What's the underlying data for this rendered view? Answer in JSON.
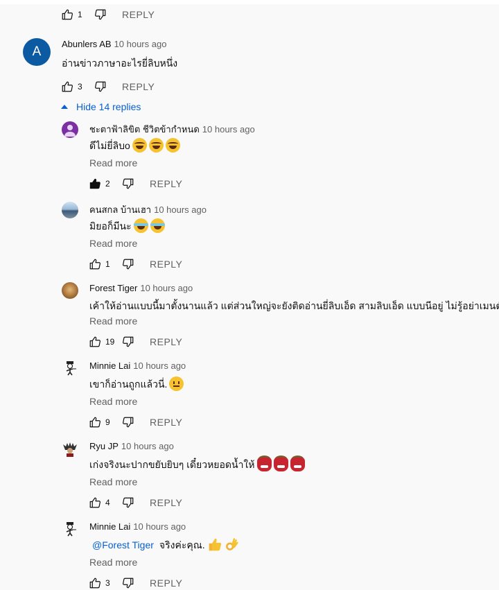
{
  "reply_label": "REPLY",
  "colors": {
    "accent": "#065fd4",
    "meta": "#606060",
    "avatar_blue": "#0b5aa2",
    "avatar_purple": "#7b2fa3"
  },
  "top_actions": {
    "likes": "1"
  },
  "main_comment": {
    "avatar_letter": "A",
    "author": "Abunlers AB",
    "time": "10 hours ago",
    "text": "อ่านข่าวภาษาอะไรยี่ลิบหนึ่ง",
    "likes": "3"
  },
  "hide_replies_label": "Hide 14 replies",
  "read_more_label": "Read more",
  "replies": [
    {
      "author": "ชะตาฟ้าลิขิต ชีวิตข้ากำหนด",
      "time": "10 hours ago",
      "text": "ดีไม่ยี่ลิบo",
      "emojis": [
        "rofl",
        "rofl",
        "rofl"
      ],
      "likes": "2",
      "liked": true,
      "avatar": "purple-person"
    },
    {
      "author": "คนสกล บ้านเฮา",
      "time": "10 hours ago",
      "text": "มิยอก็มีนะ",
      "emojis": [
        "joy",
        "joy"
      ],
      "likes": "1",
      "liked": false,
      "avatar": "landscape"
    },
    {
      "author": "Forest Tiger",
      "time": "10 hours ago",
      "text": "เค้าให้อ่านแบบนี้มาตั้งนานแล้ว แต่ส่วนใหญ่จะยังติดอ่านยี่ลิบเอ็ด สามลิบเอ็ด แบบนีอยู่ ไม่รู้อย่าเมนต์ครับ อา",
      "emojis": [],
      "likes": "19",
      "liked": false,
      "avatar": "tiger"
    },
    {
      "author": "Minnie Lai",
      "time": "10 hours ago",
      "text": "เขาก็อ่านถูกแล้วนี่.",
      "emojis": [
        "neutral"
      ],
      "likes": "9",
      "liked": false,
      "avatar": "stick-figure"
    },
    {
      "author": "Ryu JP",
      "time": "10 hours ago",
      "text": "เก่งจริงนะปากขยับยิบๆ เดี๋ยวหยอดน้ำให้",
      "emojis": [
        "ogre",
        "ogre",
        "ogre"
      ],
      "likes": "4",
      "liked": false,
      "avatar": "samurai"
    },
    {
      "author": "Minnie Lai",
      "time": "10 hours ago",
      "mention": "@Forest Tiger",
      "text": "จริงค่ะคุณ.",
      "emojis": [
        "thumbs-up",
        "ok-hand"
      ],
      "likes": "3",
      "liked": false,
      "avatar": "stick-figure"
    }
  ]
}
